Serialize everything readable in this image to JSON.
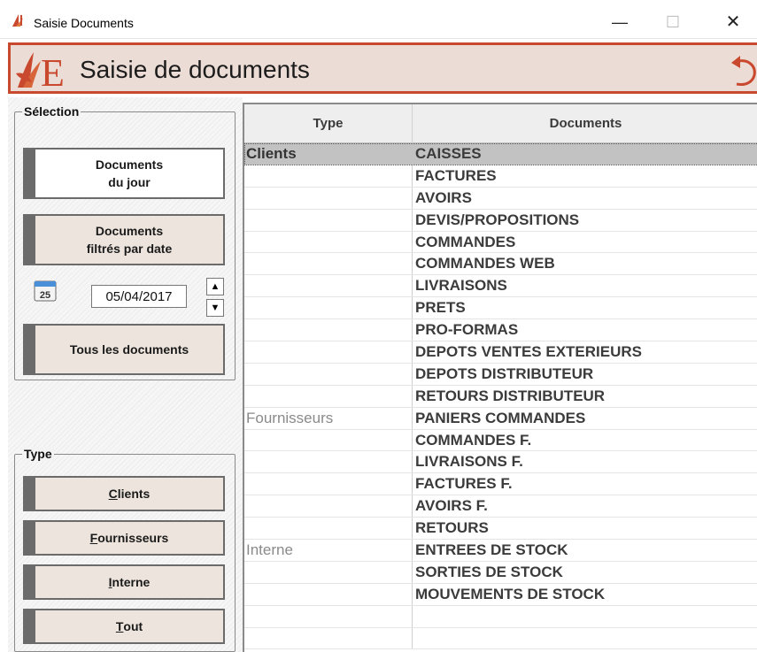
{
  "window": {
    "title": "Saisie Documents"
  },
  "header": {
    "title": "Saisie de documents"
  },
  "selection": {
    "legend": "Sélection",
    "documents_du_jour": [
      "Documents",
      "du jour"
    ],
    "documents_filtres": [
      "Documents",
      "filtrés par date"
    ],
    "date_value": "05/04/2017",
    "tous_les_documents": "Tous les documents",
    "calendar_day": "25"
  },
  "type_group": {
    "legend": "Type",
    "buttons": [
      {
        "first": "C",
        "rest": "lients"
      },
      {
        "first": "F",
        "rest": "ournisseurs"
      },
      {
        "first": "I",
        "rest": "nterne"
      },
      {
        "first": "T",
        "rest": "out"
      }
    ]
  },
  "table": {
    "columns": {
      "type": "Type",
      "documents": "Documents"
    },
    "rows": [
      {
        "type": "Clients",
        "doc": "CAISSES",
        "selected": true
      },
      {
        "type": "",
        "doc": "FACTURES"
      },
      {
        "type": "",
        "doc": "AVOIRS"
      },
      {
        "type": "",
        "doc": "DEVIS/PROPOSITIONS"
      },
      {
        "type": "",
        "doc": "COMMANDES"
      },
      {
        "type": "",
        "doc": "COMMANDES WEB"
      },
      {
        "type": "",
        "doc": "LIVRAISONS"
      },
      {
        "type": "",
        "doc": "PRETS"
      },
      {
        "type": "",
        "doc": "PRO-FORMAS"
      },
      {
        "type": "",
        "doc": "DEPOTS VENTES EXTERIEURS"
      },
      {
        "type": "",
        "doc": "DEPOTS DISTRIBUTEUR"
      },
      {
        "type": "",
        "doc": "RETOURS DISTRIBUTEUR"
      },
      {
        "type": "Fournisseurs",
        "doc": "PANIERS COMMANDES"
      },
      {
        "type": "",
        "doc": "COMMANDES F."
      },
      {
        "type": "",
        "doc": "LIVRAISONS F."
      },
      {
        "type": "",
        "doc": "FACTURES F."
      },
      {
        "type": "",
        "doc": "AVOIRS F."
      },
      {
        "type": "",
        "doc": "RETOURS"
      },
      {
        "type": "Interne",
        "doc": "ENTREES DE STOCK"
      },
      {
        "type": "",
        "doc": "SORTIES DE STOCK"
      },
      {
        "type": "",
        "doc": "MOUVEMENTS DE STOCK"
      },
      {
        "type": "",
        "doc": ""
      },
      {
        "type": "",
        "doc": ""
      }
    ]
  },
  "colors": {
    "accent": "#c9492e",
    "banner_bg": "#ecdcd6",
    "button_bg": "#ede5dd"
  },
  "icons": {
    "app": "logo-icon",
    "undo": "undo-icon",
    "calendar": "calendar-icon"
  }
}
